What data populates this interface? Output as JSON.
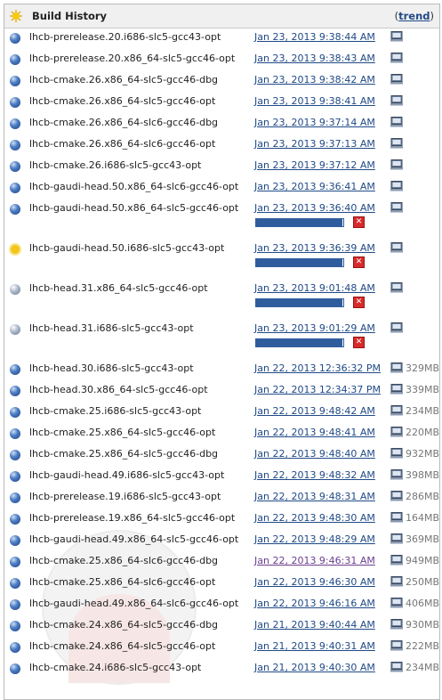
{
  "header": {
    "title": "Build History",
    "trend_open": "(",
    "trend_label": "trend",
    "trend_close": ")"
  },
  "colors": {
    "link": "#204a87",
    "visited": "#6b3d8f",
    "progress": "#2e5c9d",
    "stop": "#d62b2b"
  },
  "builds": [
    {
      "name": "lhcb-prerelease.20.i686-slc5-gcc43-opt",
      "date": "Jan 23, 2013 9:38:44 AM",
      "size": "",
      "status": "blue",
      "icon": "blue-ball-icon"
    },
    {
      "name": "lhcb-prerelease.20.x86_64-slc5-gcc46-opt",
      "date": "Jan 23, 2013 9:38:43 AM",
      "size": "",
      "status": "blue",
      "icon": "blue-ball-icon"
    },
    {
      "name": "lhcb-cmake.26.x86_64-slc5-gcc46-dbg",
      "date": "Jan 23, 2013 9:38:42 AM",
      "size": "",
      "status": "blue",
      "icon": "blue-ball-icon"
    },
    {
      "name": "lhcb-cmake.26.x86_64-slc5-gcc46-opt",
      "date": "Jan 23, 2013 9:38:41 AM",
      "size": "",
      "status": "blue",
      "icon": "blue-ball-icon"
    },
    {
      "name": "lhcb-cmake.26.x86_64-slc6-gcc46-dbg",
      "date": "Jan 23, 2013 9:37:14 AM",
      "size": "",
      "status": "blue",
      "icon": "blue-ball-icon"
    },
    {
      "name": "lhcb-cmake.26.x86_64-slc6-gcc46-opt",
      "date": "Jan 23, 2013 9:37:13 AM",
      "size": "",
      "status": "blue",
      "icon": "blue-ball-icon"
    },
    {
      "name": "lhcb-cmake.26.i686-slc5-gcc43-opt",
      "date": "Jan 23, 2013 9:37:12 AM",
      "size": "",
      "status": "blue",
      "icon": "blue-ball-icon"
    },
    {
      "name": "lhcb-gaudi-head.50.x86_64-slc6-gcc46-opt",
      "date": "Jan 23, 2013 9:36:41 AM",
      "size": "",
      "status": "blue",
      "icon": "blue-ball-icon"
    },
    {
      "name": "lhcb-gaudi-head.50.x86_64-slc5-gcc46-opt",
      "date": "Jan 23, 2013 9:36:40 AM",
      "size": "",
      "status": "blue",
      "icon": "blue-ball-icon",
      "progress": 0.99
    },
    {
      "name": "lhcb-gaudi-head.50.i686-slc5-gcc43-opt",
      "date": "Jan 23, 2013 9:36:39 AM",
      "size": "",
      "status": "yellow",
      "icon": "sun-icon",
      "progress": 0.99
    },
    {
      "name": "lhcb-head.31.x86_64-slc5-gcc46-opt",
      "date": "Jan 23, 2013 9:01:48 AM",
      "size": "",
      "status": "grey",
      "icon": "grey-ball-icon",
      "progress": 0.99
    },
    {
      "name": "lhcb-head.31.i686-slc5-gcc43-opt",
      "date": "Jan 23, 2013 9:01:29 AM",
      "size": "",
      "status": "grey",
      "icon": "grey-ball-icon",
      "progress": 0.99
    },
    {
      "name": "lhcb-head.30.i686-slc5-gcc43-opt",
      "date": "Jan 22, 2013 12:36:32 PM",
      "size": "329MB",
      "status": "blue",
      "icon": "blue-ball-icon"
    },
    {
      "name": "lhcb-head.30.x86_64-slc5-gcc46-opt",
      "date": "Jan 22, 2013 12:34:37 PM",
      "size": "339MB",
      "status": "blue",
      "icon": "blue-ball-icon"
    },
    {
      "name": "lhcb-cmake.25.i686-slc5-gcc43-opt",
      "date": "Jan 22, 2013 9:48:42 AM",
      "size": "234MB",
      "status": "blue",
      "icon": "blue-ball-icon"
    },
    {
      "name": "lhcb-cmake.25.x86_64-slc5-gcc46-opt",
      "date": "Jan 22, 2013 9:48:41 AM",
      "size": "220MB",
      "status": "blue",
      "icon": "blue-ball-icon"
    },
    {
      "name": "lhcb-cmake.25.x86_64-slc5-gcc46-dbg",
      "date": "Jan 22, 2013 9:48:40 AM",
      "size": "932MB",
      "status": "blue",
      "icon": "blue-ball-icon"
    },
    {
      "name": "lhcb-gaudi-head.49.i686-slc5-gcc43-opt",
      "date": "Jan 22, 2013 9:48:32 AM",
      "size": "398MB",
      "status": "blue",
      "icon": "blue-ball-icon"
    },
    {
      "name": "lhcb-prerelease.19.i686-slc5-gcc43-opt",
      "date": "Jan 22, 2013 9:48:31 AM",
      "size": "286MB",
      "status": "blue",
      "icon": "blue-ball-icon"
    },
    {
      "name": "lhcb-prerelease.19.x86_64-slc5-gcc46-opt",
      "date": "Jan 22, 2013 9:48:30 AM",
      "size": "164MB",
      "status": "blue",
      "icon": "blue-ball-icon"
    },
    {
      "name": "lhcb-gaudi-head.49.x86_64-slc5-gcc46-opt",
      "date": "Jan 22, 2013 9:48:29 AM",
      "size": "369MB",
      "status": "blue",
      "icon": "blue-ball-icon"
    },
    {
      "name": "lhcb-cmake.25.x86_64-slc6-gcc46-dbg",
      "date": "Jan 22, 2013 9:46:31 AM",
      "size": "949MB",
      "status": "blue",
      "icon": "blue-ball-icon",
      "visited": true
    },
    {
      "name": "lhcb-cmake.25.x86_64-slc6-gcc46-opt",
      "date": "Jan 22, 2013 9:46:30 AM",
      "size": "250MB",
      "status": "blue",
      "icon": "blue-ball-icon"
    },
    {
      "name": "lhcb-gaudi-head.49.x86_64-slc6-gcc46-opt",
      "date": "Jan 22, 2013 9:46:16 AM",
      "size": "406MB",
      "status": "blue",
      "icon": "blue-ball-icon"
    },
    {
      "name": "lhcb-cmake.24.x86_64-slc5-gcc46-dbg",
      "date": "Jan 21, 2013 9:40:44 AM",
      "size": "930MB",
      "status": "blue",
      "icon": "blue-ball-icon"
    },
    {
      "name": "lhcb-cmake.24.x86_64-slc5-gcc46-opt",
      "date": "Jan 21, 2013 9:40:31 AM",
      "size": "222MB",
      "status": "blue",
      "icon": "blue-ball-icon"
    },
    {
      "name": "lhcb-cmake.24.i686-slc5-gcc43-opt",
      "date": "Jan 21, 2013 9:40:30 AM",
      "size": "234MB",
      "status": "blue",
      "icon": "blue-ball-icon"
    }
  ]
}
